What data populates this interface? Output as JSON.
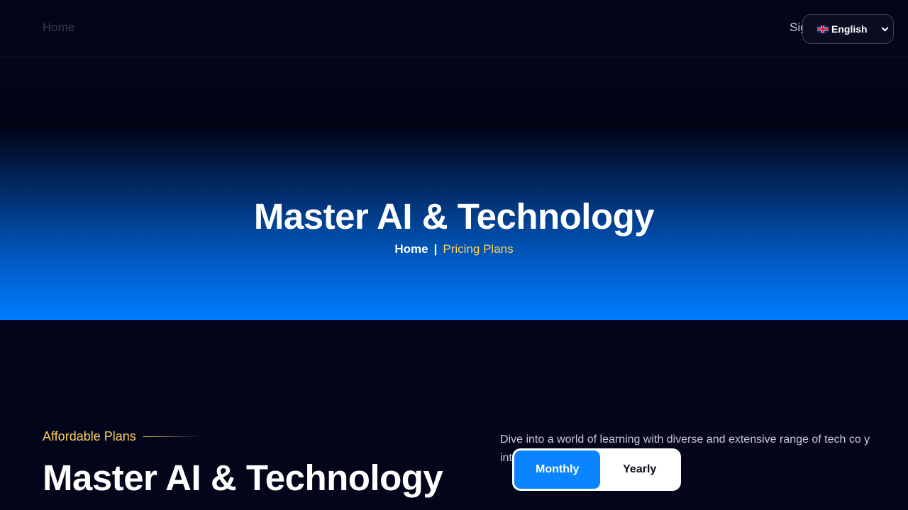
{
  "header": {
    "home_link": "Home",
    "signin_link": "Sig",
    "language": {
      "selected": "English",
      "flag_icon": "uk-flag-icon"
    }
  },
  "hero": {
    "title": "Master AI & Technology",
    "breadcrumb": {
      "home": "Home",
      "separator": "|",
      "current": "Pricing Plans"
    }
  },
  "plans_section": {
    "eyebrow": "Affordable Plans",
    "title": "Master AI & Technology",
    "description": "Dive into a world of learning with diverse and extensive range of tech co y interest."
  },
  "billing_toggle": {
    "options": [
      "Monthly",
      "Yearly"
    ],
    "active": "Monthly"
  },
  "colors": {
    "background": "#03051a",
    "accent_blue": "#007dff",
    "accent_gold": "#ffcf5c"
  }
}
